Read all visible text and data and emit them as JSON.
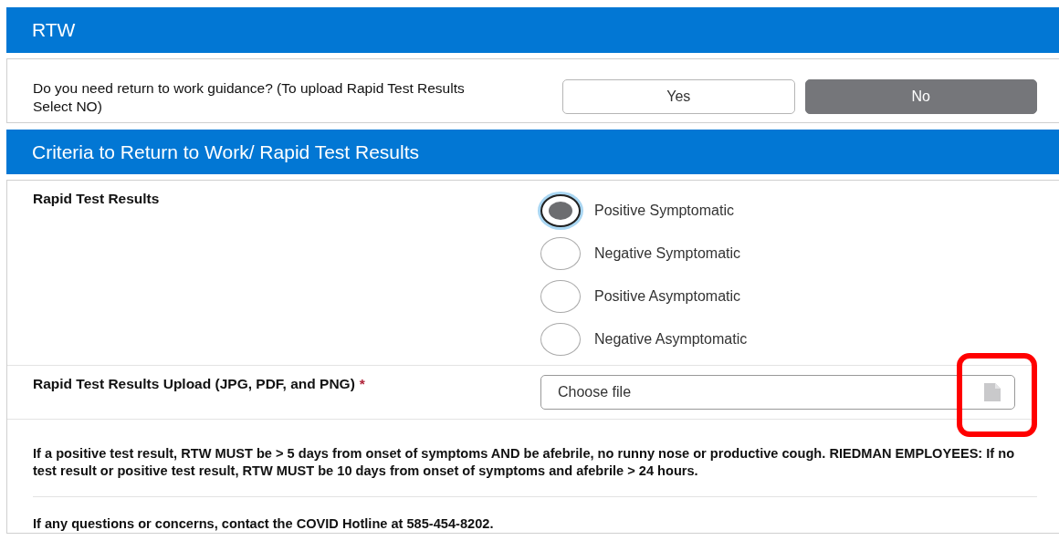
{
  "sections": [
    {
      "title": "RTW"
    },
    {
      "title": "Criteria to Return to Work/ Rapid Test Results"
    }
  ],
  "guidance": {
    "question": "Do you need return to work guidance? (To upload Rapid Test Results Select NO)",
    "options": [
      {
        "label": "Yes",
        "selected": false
      },
      {
        "label": "No",
        "selected": true
      }
    ]
  },
  "rapid_test": {
    "label": "Rapid Test Results",
    "options": [
      {
        "label": "Positive Symptomatic",
        "selected": true,
        "focused": true
      },
      {
        "label": "Negative Symptomatic",
        "selected": false,
        "focused": false
      },
      {
        "label": "Positive Asymptomatic",
        "selected": false,
        "focused": false
      },
      {
        "label": "Negative Asymptomatic",
        "selected": false,
        "focused": false
      }
    ]
  },
  "upload": {
    "label": "Rapid Test Results Upload (JPG, PDF, and PNG)",
    "required_mark": "*",
    "placeholder": "Choose file",
    "highlighted": true
  },
  "notes": [
    "If a positive test result, RTW MUST be > 5 days from onset of symptoms AND be afebrile, no runny nose or productive cough. RIEDMAN EMPLOYEES: If no test result or positive test result, RTW MUST be 10 days from onset of symptoms and afebrile > 24 hours.",
    "If any questions or concerns, contact the COVID Hotline at 585-454-8202."
  ]
}
